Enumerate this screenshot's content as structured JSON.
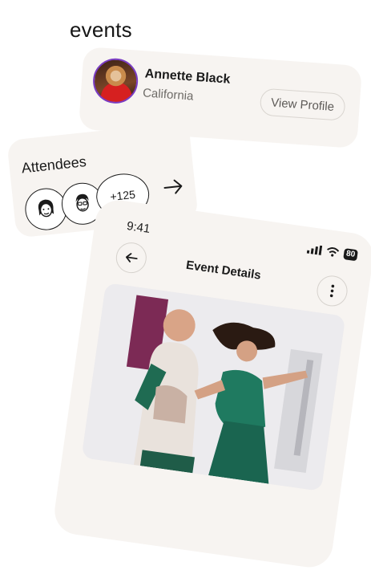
{
  "page": {
    "heading": "events"
  },
  "profile": {
    "name": "Annette Black",
    "location": "California",
    "view_button": "View Profile",
    "ring_color": "#7a3cc2"
  },
  "attendees": {
    "title": "Attendees",
    "more_count": "+125"
  },
  "phone": {
    "time": "9:41",
    "battery": "80",
    "title": "Event Details"
  },
  "icons": [
    "avatar-photo",
    "person-avatar-1",
    "person-avatar-2",
    "arrow-right-icon",
    "back-arrow-icon",
    "more-vertical-icon",
    "signal-icon",
    "wifi-icon",
    "battery-icon"
  ]
}
